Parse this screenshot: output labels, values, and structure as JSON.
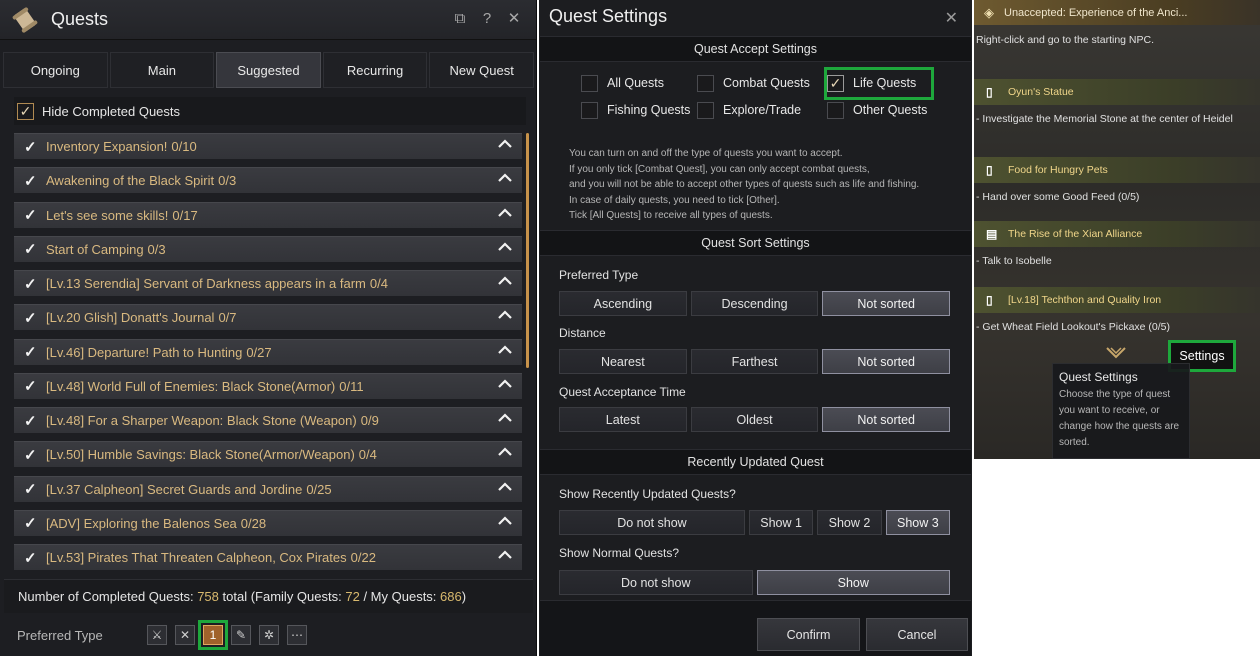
{
  "quests_window": {
    "title": "Quests",
    "tabs": [
      "Ongoing",
      "Main",
      "Suggested",
      "Recurring",
      "New Quest"
    ],
    "active_tab": "Suggested",
    "hide_completed_label": "Hide Completed Quests",
    "hide_completed_checked": true,
    "quests": [
      {
        "title": "Inventory Expansion!",
        "count": "0/10"
      },
      {
        "title": "Awakening of the Black Spirit",
        "count": "0/3"
      },
      {
        "title": "Let's see some skills!",
        "count": "0/17"
      },
      {
        "title": "Start of Camping",
        "count": "0/3"
      },
      {
        "title": "[Lv.13 Serendia] Servant of Darkness appears in a farm",
        "count": "0/4"
      },
      {
        "title": "[Lv.20 Glish] Donatt's Journal",
        "count": "0/7"
      },
      {
        "title": "[Lv.46] Departure! Path to Hunting",
        "count": "0/27"
      },
      {
        "title": "[Lv.48] World Full of Enemies: Black Stone(Armor)",
        "count": "0/11"
      },
      {
        "title": "[Lv.48] For a Sharper Weapon: Black Stone (Weapon)",
        "count": "0/9"
      },
      {
        "title": "[Lv.50] Humble Savings: Black Stone(Armor/Weapon)",
        "count": "0/4"
      },
      {
        "title": "[Lv.37 Calpheon] Secret Guards and Jordine",
        "count": "0/25"
      },
      {
        "title": "[ADV] Exploring the Balenos Sea",
        "count": "0/28"
      },
      {
        "title": "[Lv.53] Pirates That Threaten Calpheon, Cox Pirates",
        "count": "0/22"
      }
    ],
    "completed": {
      "prefix": "Number of Completed Quests:",
      "total": "758",
      "total_label": "total (Family Quests:",
      "family": "72",
      "sep": "/ My Quests:",
      "my": "686",
      "suffix": ")"
    },
    "preferred_type_label": "Preferred Type",
    "preferred_icons": [
      "combat-icon",
      "cross-icon",
      "life-icon",
      "fishing-icon",
      "trade-icon",
      "more-icon"
    ],
    "preferred_selected_glyph": "1"
  },
  "settings_window": {
    "title": "Quest Settings",
    "accept_header": "Quest Accept Settings",
    "accept_options": [
      {
        "label": "All Quests",
        "checked": false
      },
      {
        "label": "Combat Quests",
        "checked": false
      },
      {
        "label": "Life Quests",
        "checked": true
      },
      {
        "label": "Fishing Quests",
        "checked": false
      },
      {
        "label": "Explore/Trade",
        "checked": false
      },
      {
        "label": "Other Quests",
        "checked": false
      }
    ],
    "note_lines": [
      "You can turn on and off the type of quests you want to accept.",
      "If you only tick [Combat Quest], you can only accept combat quests,",
      "and you will not be able to accept other types of quests such as life and fishing.",
      "In case of daily quests, you need to tick [Other].",
      "Tick [All Quests] to receive all types of quests."
    ],
    "sort_header": "Quest Sort Settings",
    "preferred_type_label": "Preferred Type",
    "preferred_type_options": [
      "Ascending",
      "Descending",
      "Not sorted"
    ],
    "distance_label": "Distance",
    "distance_options": [
      "Nearest",
      "Farthest",
      "Not sorted"
    ],
    "acceptance_time_label": "Quest Acceptance Time",
    "acceptance_time_options": [
      "Latest",
      "Oldest",
      "Not sorted"
    ],
    "recent_header": "Recently Updated Quest",
    "show_recent_label": "Show Recently Updated Quests?",
    "show_recent_options": [
      "Do not show",
      "Show 1",
      "Show 2",
      "Show 3"
    ],
    "show_normal_label": "Show Normal Quests?",
    "show_normal_options": [
      "Do not show",
      "Show"
    ],
    "confirm_label": "Confirm",
    "cancel_label": "Cancel"
  },
  "quest_panel": {
    "top_title": "Unaccepted: Experience of the Anci...",
    "top_hint": "Right-click and go to the starting NPC.",
    "entries": [
      {
        "name": "Oyun's Statue",
        "icon": "quest-marker-icon",
        "desc": "- Investigate the Memorial Stone at the center of Heidel"
      },
      {
        "name": "Food for Hungry Pets",
        "icon": "quest-marker-icon",
        "desc": "- Hand over some Good Feed (0/5)"
      },
      {
        "name": "The Rise of the Xian Alliance",
        "icon": "book-icon",
        "desc": "- Talk to Isobelle"
      },
      {
        "name": "[Lv.18] Techthon and Quality Iron",
        "icon": "quest-marker-icon",
        "desc": "- Get Wheat Field Lookout's Pickaxe (0/5)"
      }
    ],
    "settings_button": "Settings",
    "tooltip_title": "Quest Settings",
    "tooltip_body": "Choose the type of quest you want to receive, or change how the quests are sorted."
  }
}
